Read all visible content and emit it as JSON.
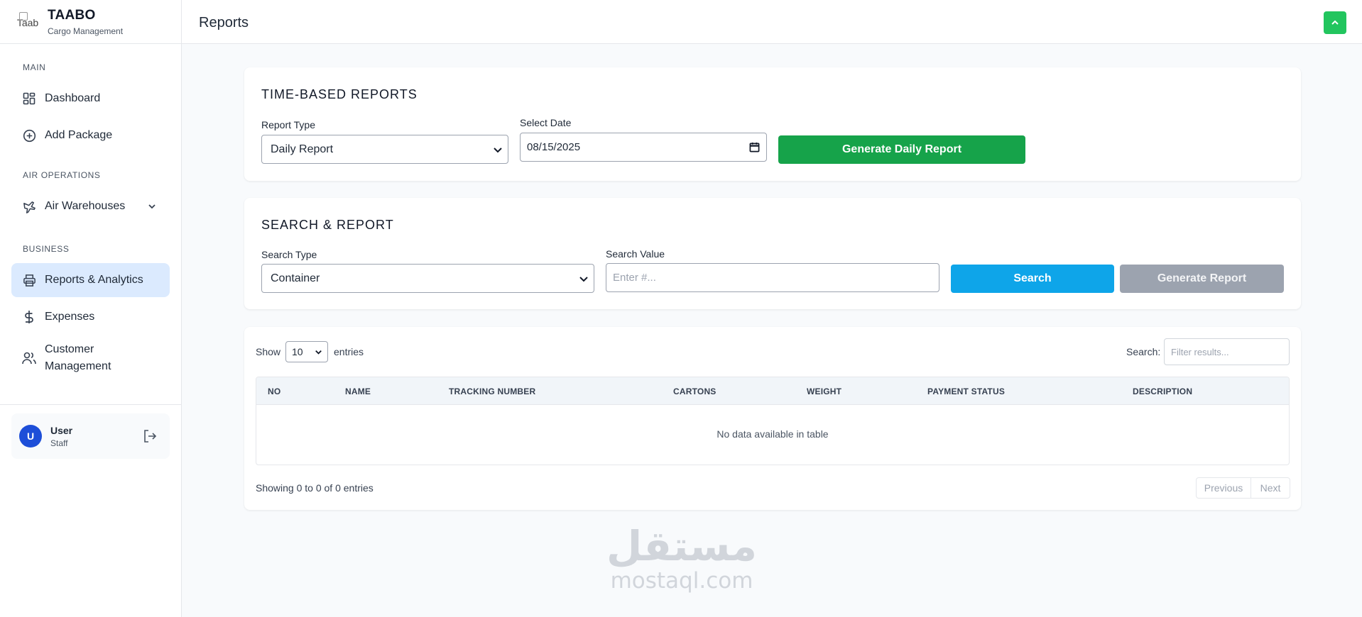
{
  "app": {
    "name": "TAABO",
    "subtitle": "Cargo Management",
    "logo_alt": "Taab"
  },
  "sidebar": {
    "sections": {
      "main": "MAIN",
      "air": "AIR OPERATIONS",
      "business": "BUSINESS"
    },
    "items": [
      {
        "label": "Dashboard",
        "icon": "grid-icon"
      },
      {
        "label": "Add Package",
        "icon": "plus-circle-icon"
      },
      {
        "label": "Air Warehouses",
        "icon": "plane-icon"
      },
      {
        "label": "Reports & Analytics",
        "icon": "printer-icon",
        "active": true
      },
      {
        "label": "Expenses",
        "icon": "dollar-icon"
      },
      {
        "label": "Customer Management",
        "label_line1": "Customer",
        "label_line2": "Management",
        "icon": "users-icon"
      }
    ],
    "user": {
      "initial": "U",
      "name": "User",
      "role": "Staff"
    }
  },
  "header": {
    "title": "Reports"
  },
  "time_reports": {
    "title": "TIME-BASED REPORTS",
    "report_type_label": "Report Type",
    "report_type_value": "Daily Report",
    "date_label": "Select Date",
    "date_value": "08/15/2025",
    "generate_label": "Generate Daily Report"
  },
  "search_report": {
    "title": "SEARCH & REPORT",
    "search_type_label": "Search Type",
    "search_type_value": "Container",
    "search_value_label": "Search Value",
    "search_value_placeholder": "Enter #...",
    "search_button": "Search",
    "generate_button": "Generate Report"
  },
  "table": {
    "show_label": "Show",
    "entries_value": "10",
    "entries_label": "entries",
    "search_label": "Search:",
    "filter_placeholder": "Filter results...",
    "columns": [
      "NO",
      "NAME",
      "TRACKING NUMBER",
      "CARTONS",
      "WEIGHT",
      "PAYMENT STATUS",
      "DESCRIPTION"
    ],
    "empty_text": "No data available in table",
    "info": "Showing 0 to 0 of 0 entries",
    "prev": "Previous",
    "next": "Next"
  },
  "watermark": {
    "arabic": "مستقل",
    "latin": "mostaql.com"
  },
  "colors": {
    "green": "#16a34a",
    "blue": "#0ea5e9",
    "gray_button": "#9ca3af",
    "active_bg": "#dbeafe",
    "avatar": "#1d4ed8"
  }
}
